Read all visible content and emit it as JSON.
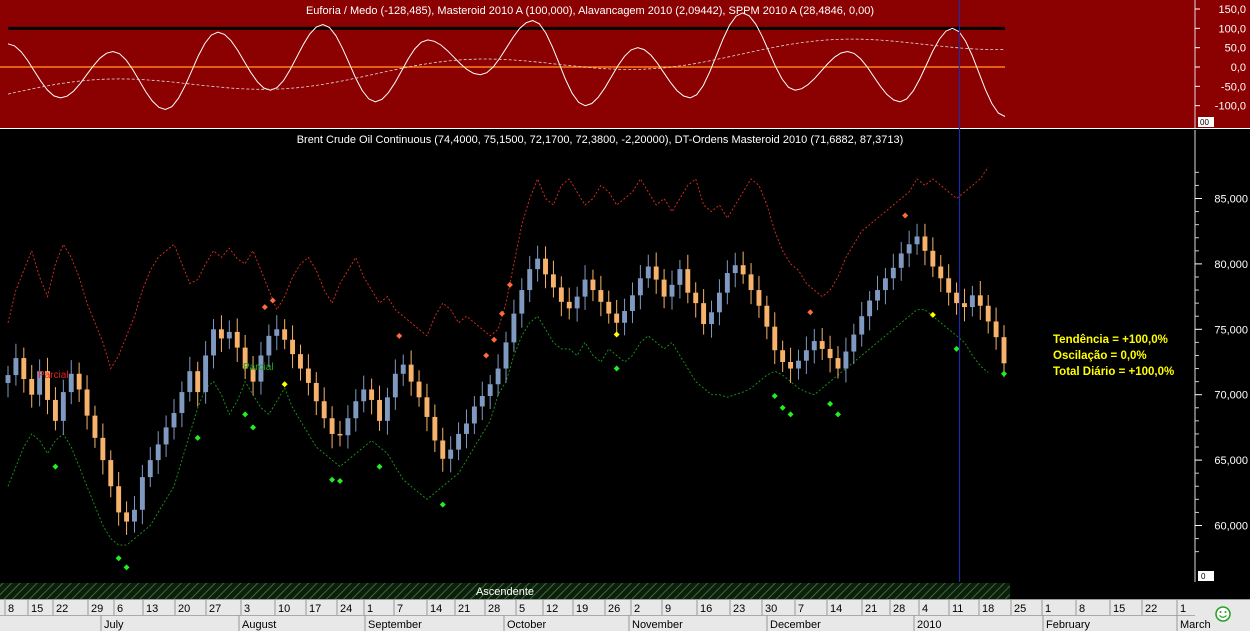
{
  "colors": {
    "top_bg": "#8b0000",
    "main_bg": "#000000",
    "bull_candle": "#7f99c0",
    "bear_candle": "#f7b26b",
    "upper_band": "#e03020",
    "lower_band": "#1a9a1a",
    "cursor": "#1e2ca8",
    "info_text": "#ffff00"
  },
  "top_panel": {
    "title": "Euforia / Medo (-128,485), Masteroid 2010 A (100,000), Alavancagem 2010 (2,09442), SPPM 2010 A (28,4846, 0,00)",
    "y_ticks": [
      "150,0",
      "100,0",
      "50,0",
      "0,0",
      "-50,0",
      "-100,0"
    ],
    "small_label": "00"
  },
  "main_panel": {
    "title": "Brent Crude Oil Continuous (74,4000, 75,1500, 72,1700, 72,3800, -2,20000), DT-Ordens Masteroid 2010 (71,6882, 87,3713)",
    "y_ticks": [
      "85,000",
      "80,000",
      "75,000",
      "70,000",
      "65,000",
      "60,000"
    ],
    "small_label": "0",
    "annotations": {
      "parcial_1": "Parcial",
      "parcial_2": "Parcial"
    }
  },
  "info_box": {
    "line1": "Tendência = +100,0%",
    "line2": "Oscilação = 0,0%",
    "line3": "Total Diário = +100,0%"
  },
  "trend_band_label": "Ascendente",
  "x_axis": {
    "day_labels": [
      "8",
      "15",
      "22",
      "29",
      "6",
      "13",
      "20",
      "27",
      "3",
      "10",
      "17",
      "24",
      "1",
      "7",
      "14",
      "21",
      "28",
      "5",
      "12",
      "19",
      "26",
      "2",
      "9",
      "16",
      "23",
      "30",
      "7",
      "14",
      "21",
      "28",
      "4",
      "11",
      "18",
      "25",
      "1",
      "8",
      "15",
      "22",
      "1"
    ],
    "month_labels": [
      "July",
      "August",
      "September",
      "October",
      "November",
      "December",
      "2010",
      "February",
      "March"
    ]
  },
  "chart_data": [
    {
      "type": "line",
      "title": "Euforia / Medo (-128,485), Masteroid 2010 A (100,000), Alavancagem 2010 (2,09442), SPPM 2010 A (28,4846, 0,00)",
      "ylim": [
        -150,
        150
      ],
      "series": [
        {
          "name": "Masteroid 2010 A",
          "values": [
            100,
            100,
            100,
            100,
            100,
            100,
            100,
            100,
            100,
            100,
            100,
            100,
            100,
            100,
            100,
            100,
            100,
            100,
            100,
            100
          ]
        },
        {
          "name": "Euforia / Medo",
          "values": [
            60,
            -80,
            40,
            -110,
            90,
            -60,
            110,
            -90,
            70,
            -20,
            120,
            -100,
            50,
            -80,
            140,
            -60,
            40,
            -90,
            100,
            -128
          ]
        }
      ]
    },
    {
      "type": "candlestick",
      "title": "Brent Crude Oil Continuous (74,4000, 75,1500, 72,1700, 72,3800, -2,20000), DT-Ordens Masteroid 2010 (71,6882, 87,3713)",
      "ylim": [
        57,
        88
      ],
      "x_start": "2009-07-06",
      "closes": [
        71.5,
        72.8,
        71.2,
        70.0,
        71.8,
        69.6,
        68.0,
        70.2,
        71.6,
        70.4,
        68.4,
        66.7,
        65.0,
        63.0,
        61.0,
        60.3,
        61.2,
        63.7,
        65.0,
        66.2,
        67.5,
        68.6,
        70.2,
        71.8,
        70.2,
        73.0,
        75.0,
        74.3,
        74.8,
        73.6,
        72.0,
        71.0,
        73.0,
        74.5,
        75.0,
        74.2,
        73.1,
        72.0,
        70.9,
        69.5,
        68.2,
        67.0,
        66.9,
        68.2,
        69.5,
        70.4,
        69.6,
        68.0,
        69.8,
        71.6,
        72.3,
        71.0,
        69.8,
        68.3,
        66.5,
        65.1,
        65.8,
        67.0,
        67.8,
        69.1,
        69.9,
        70.8,
        72.0,
        74.0,
        76.2,
        78.0,
        79.6,
        80.4,
        79.2,
        78.2,
        77.1,
        76.6,
        77.5,
        78.8,
        78.0,
        77.1,
        76.2,
        75.5,
        76.4,
        77.6,
        78.9,
        79.8,
        78.8,
        77.5,
        78.4,
        79.6,
        77.8,
        77.0,
        75.4,
        76.3,
        77.8,
        79.3,
        79.9,
        79.2,
        78.0,
        76.8,
        75.2,
        73.4,
        72.5,
        72.0,
        72.6,
        73.4,
        74.1,
        73.5,
        72.8,
        72.0,
        73.3,
        74.6,
        76.0,
        77.2,
        78.0,
        78.9,
        79.7,
        80.8,
        81.5,
        82.1,
        81.0,
        79.8,
        78.9,
        77.8,
        77.0,
        76.7,
        77.6,
        76.8,
        75.6,
        74.4,
        72.4
      ],
      "upper_band": [
        75.5,
        78.0,
        79.5,
        81.0,
        79.0,
        77.5,
        80.0,
        81.5,
        80.5,
        79.0,
        77.0,
        75.5,
        74.0,
        72.0,
        73.0,
        74.5,
        76.0,
        78.0,
        79.5,
        80.5,
        81.0,
        81.5,
        80.0,
        78.5,
        78.8,
        80.0,
        81.0,
        80.5,
        81.2,
        80.4,
        80.0,
        81.0,
        79.5,
        78.0,
        76.5,
        77.5,
        79.0,
        80.0,
        80.5,
        79.5,
        78.0,
        77.0,
        78.5,
        79.5,
        80.5,
        79.0,
        78.0,
        77.0,
        77.5,
        76.5,
        76.0,
        75.5,
        75.0,
        74.5,
        76.0,
        77.0,
        76.5,
        75.5,
        76.0,
        75.5,
        75.0,
        74.5,
        75.0,
        77.0,
        80.0,
        83.0,
        85.0,
        86.5,
        85.0,
        84.5,
        86.0,
        86.5,
        85.5,
        84.5,
        85.0,
        86.0,
        85.5,
        84.5,
        85.0,
        85.5,
        86.5,
        85.5,
        84.5,
        85.0,
        84.0,
        85.0,
        86.0,
        86.5,
        84.5,
        84.0,
        84.5,
        83.5,
        84.5,
        85.5,
        86.5,
        86.0,
        84.5,
        82.5,
        81.0,
        80.0,
        79.5,
        78.5,
        78.0,
        77.5,
        78.0,
        79.0,
        80.5,
        81.5,
        82.5,
        83.0,
        83.5,
        84.0,
        84.5,
        85.0,
        85.5,
        86.5,
        86.0,
        86.5,
        86.0,
        85.5,
        85.0,
        85.5,
        86.0,
        86.5,
        87.4
      ],
      "lower_band": [
        63.0,
        64.5,
        66.0,
        67.0,
        66.5,
        65.5,
        66.5,
        67.0,
        66.0,
        64.5,
        63.0,
        61.5,
        60.0,
        59.0,
        58.5,
        58.5,
        59.0,
        59.5,
        60.0,
        61.0,
        62.0,
        63.0,
        65.0,
        67.0,
        69.0,
        70.5,
        71.0,
        70.0,
        68.5,
        69.5,
        71.0,
        70.0,
        69.0,
        68.5,
        69.5,
        70.5,
        69.0,
        68.0,
        67.0,
        66.0,
        65.5,
        65.0,
        64.5,
        65.0,
        65.5,
        66.0,
        66.5,
        66.0,
        65.5,
        64.5,
        63.5,
        63.0,
        62.5,
        62.0,
        62.5,
        63.0,
        63.5,
        64.0,
        65.0,
        66.0,
        67.0,
        68.0,
        70.0,
        71.0,
        73.0,
        74.5,
        75.5,
        76.0,
        75.0,
        74.0,
        73.5,
        73.5,
        73.0,
        74.0,
        73.0,
        72.5,
        73.5,
        73.0,
        72.5,
        73.0,
        74.0,
        74.5,
        74.0,
        73.5,
        74.0,
        73.0,
        72.0,
        71.0,
        70.5,
        70.0,
        70.0,
        69.8,
        70.0,
        70.2,
        70.5,
        71.0,
        71.5,
        71.8,
        71.5,
        71.0,
        70.5,
        70.2,
        70.0,
        70.5,
        71.0,
        71.5,
        72.0,
        72.5,
        73.0,
        73.5,
        74.0,
        74.5,
        75.0,
        75.5,
        76.0,
        76.5,
        76.5,
        76.0,
        75.5,
        75.0,
        74.5,
        74.0,
        73.0,
        72.2,
        71.7
      ],
      "series": [
        {
          "name": "Brent Crude Oil Continuous",
          "last": {
            "open": 74.4,
            "high": 75.15,
            "low": 72.17,
            "close": 72.38,
            "change": -2.2
          }
        },
        {
          "name": "DT-Ordens Masteroid 2010",
          "values": [
            71.6882,
            87.3713
          ]
        }
      ]
    }
  ]
}
